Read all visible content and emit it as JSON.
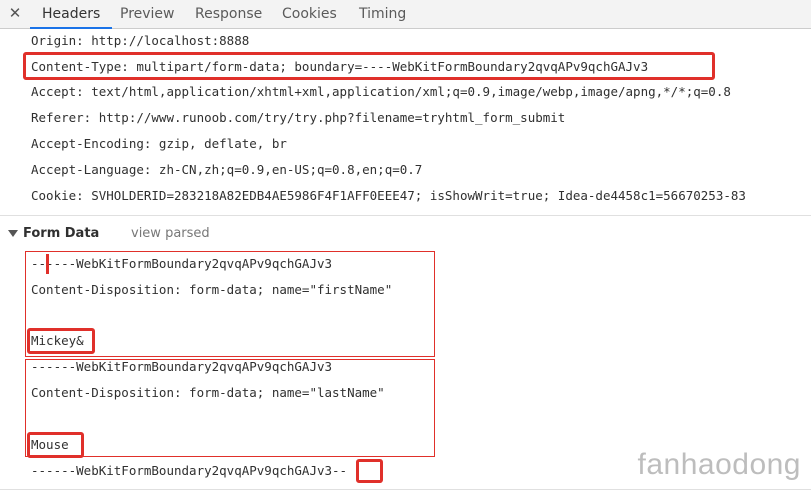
{
  "tabs": {
    "close_glyph": "✕",
    "items": [
      "Headers",
      "Preview",
      "Response",
      "Cookies",
      "Timing"
    ],
    "active": "Headers"
  },
  "request_headers": [
    "Origin: http://localhost:8888",
    "Content-Type: multipart/form-data; boundary=----WebKitFormBoundary2qvqAPv9qchGAJv3",
    "Accept: text/html,application/xhtml+xml,application/xml;q=0.9,image/webp,image/apng,*/*;q=0.8",
    "Referer: http://www.runoob.com/try/try.php?filename=tryhtml_form_submit",
    "Accept-Encoding: gzip, deflate, br",
    "Accept-Language: zh-CN,zh;q=0.9,en-US;q=0.8,en;q=0.7",
    "Cookie: SVHOLDERID=283218A82EDB4AE5986F4F1AFF0EEE47; isShowWrit=true; Idea-de4458c1=56670253-83"
  ],
  "form_data": {
    "title": "Form Data",
    "view_parsed": "view parsed",
    "part1": {
      "boundary": "------WebKitFormBoundary2qvqAPv9qchGAJv3",
      "disposition": "Content-Disposition: form-data; name=\"firstName\"",
      "value": "Mickey&"
    },
    "part2": {
      "boundary": "------WebKitFormBoundary2qvqAPv9qchGAJv3",
      "disposition": "Content-Disposition: form-data; name=\"lastName\"",
      "value": "Mouse"
    },
    "closing_boundary": "------WebKitFormBoundary2qvqAPv9qchGAJv3--"
  },
  "watermark": "fanhaodong",
  "colors": {
    "highlight": "#e0302a",
    "active_tab_underline": "#1a73e8"
  }
}
